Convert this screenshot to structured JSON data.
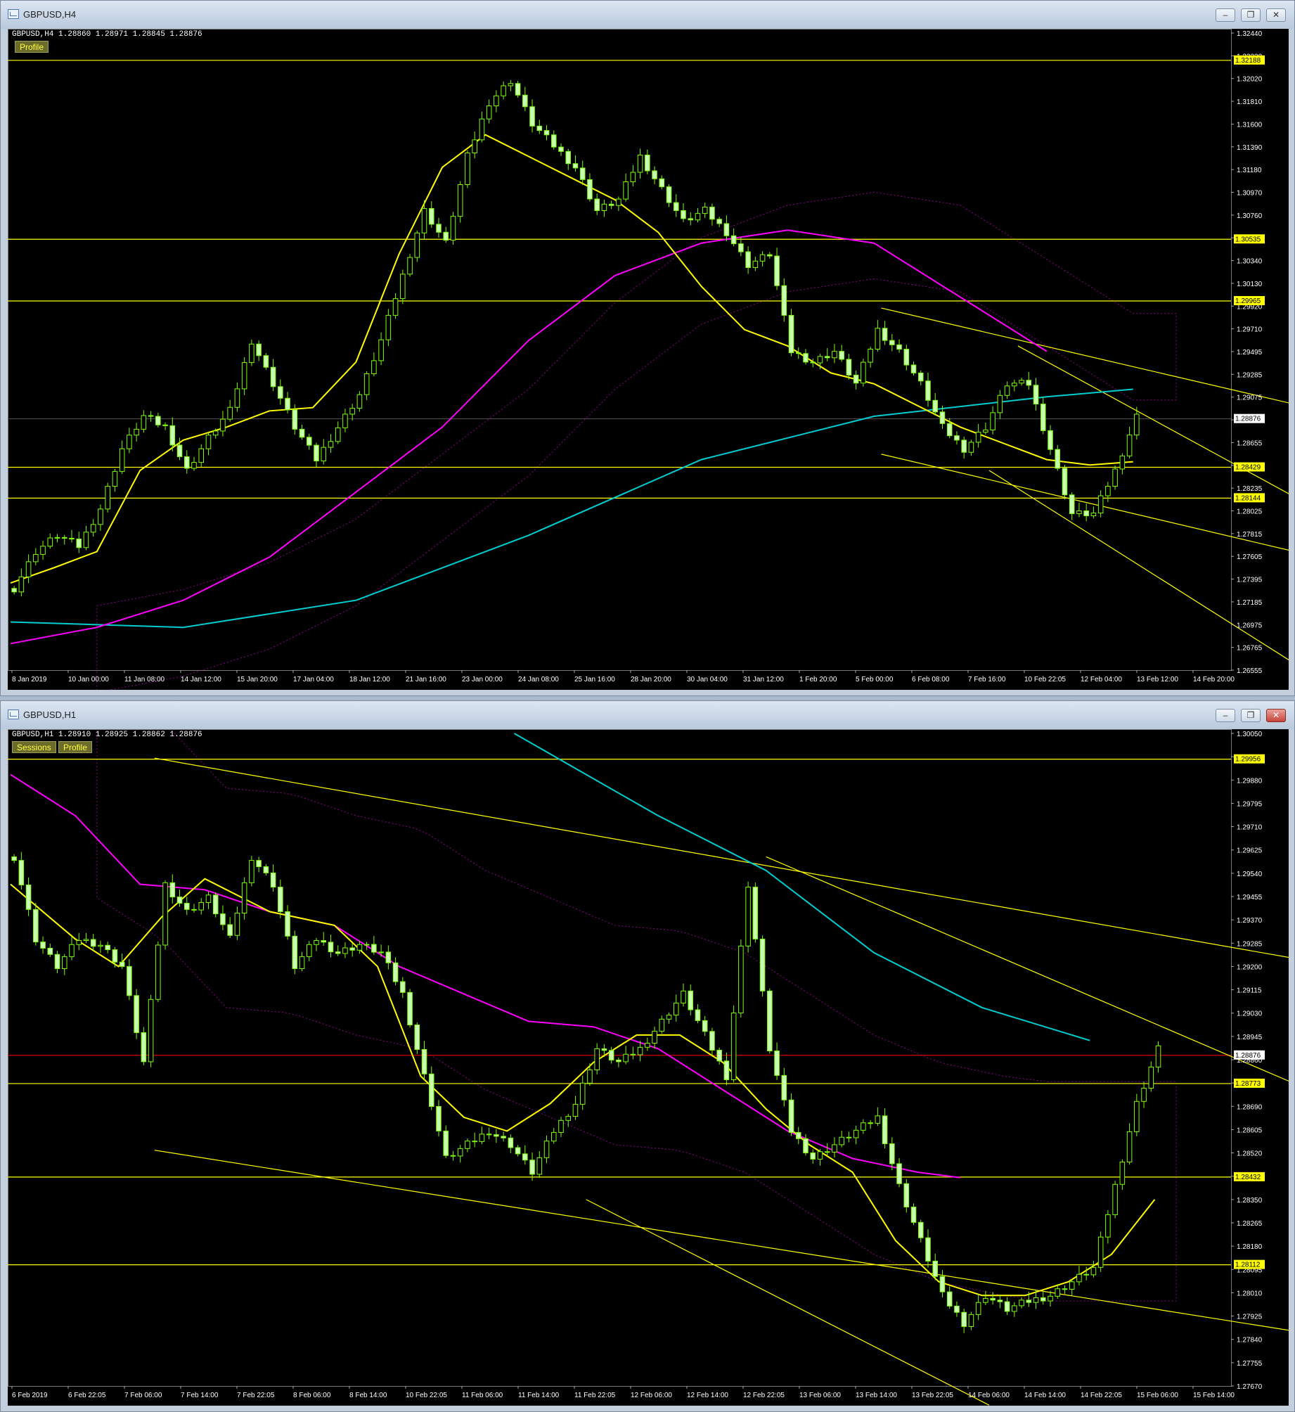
{
  "windows": [
    {
      "title": "GBPUSD,H4",
      "symbol_info": "GBPUSD,H4  1.28860 1.28971 1.28845 1.28876",
      "buttons": [
        "Profile"
      ],
      "price_scale": [
        "1.32440",
        "1.32230",
        "1.32020",
        "1.31810",
        "1.31600",
        "1.31390",
        "1.31180",
        "1.30970",
        "1.30760",
        "1.30545",
        "1.30340",
        "1.30130",
        "1.29920",
        "1.29710",
        "1.29495",
        "1.29285",
        "1.29075",
        "1.28865",
        "1.28655",
        "1.28445",
        "1.28235",
        "1.28025",
        "1.27815",
        "1.27605",
        "1.27395",
        "1.27185",
        "1.26975",
        "1.26765",
        "1.26555"
      ],
      "level_labels": [
        "1.32188",
        "1.30535",
        "1.29965",
        "1.28876",
        "1.28429",
        "1.28144"
      ],
      "time_labels": [
        "8 Jan 2019",
        "10 Jan 00:00",
        "11 Jan 08:00",
        "14 Jan 12:00",
        "15 Jan 20:00",
        "17 Jan 04:00",
        "18 Jan 12:00",
        "21 Jan 16:00",
        "23 Jan 00:00",
        "24 Jan 08:00",
        "25 Jan 16:00",
        "28 Jan 20:00",
        "30 Jan 04:00",
        "31 Jan 12:00",
        "1 Feb 20:00",
        "5 Feb 00:00",
        "6 Feb 08:00",
        "7 Feb 16:00",
        "10 Feb 22:05",
        "12 Feb 04:00",
        "13 Feb 12:00",
        "14 Feb 20:00"
      ]
    },
    {
      "title": "GBPUSD,H1",
      "symbol_info": "GBPUSD,H1  1.28910 1.28925 1.28862 1.28876",
      "buttons": [
        "Sessions",
        "Profile"
      ],
      "price_scale": [
        "1.30050",
        "1.29965",
        "1.29880",
        "1.29795",
        "1.29710",
        "1.29625",
        "1.29540",
        "1.29455",
        "1.29370",
        "1.29285",
        "1.29200",
        "1.29115",
        "1.29030",
        "1.28945",
        "1.28860",
        "1.28775",
        "1.28690",
        "1.28605",
        "1.28520",
        "1.28435",
        "1.28350",
        "1.28265",
        "1.28180",
        "1.28095",
        "1.28010",
        "1.27925",
        "1.27840",
        "1.27755",
        "1.27670"
      ],
      "level_labels": [
        "1.29956",
        "1.28876",
        "1.28773",
        "1.28432",
        "1.28112"
      ],
      "time_labels": [
        "6 Feb 2019",
        "6 Feb 22:05",
        "7 Feb 06:00",
        "7 Feb 14:00",
        "7 Feb 22:05",
        "8 Feb 06:00",
        "8 Feb 14:00",
        "10 Feb 22:05",
        "11 Feb 06:00",
        "11 Feb 14:00",
        "11 Feb 22:05",
        "12 Feb 06:00",
        "12 Feb 14:00",
        "12 Feb 22:05",
        "13 Feb 06:00",
        "13 Feb 14:00",
        "13 Feb 22:05",
        "14 Feb 06:00",
        "14 Feb 14:00",
        "14 Feb 22:05",
        "15 Feb 06:00",
        "15 Feb 14:00"
      ]
    }
  ],
  "controls": {
    "minimize_icon": "minimize-icon",
    "restore_icon": "restore-icon",
    "close_icon": "close-icon"
  },
  "colors": {
    "background": "#000000",
    "candle": "#7cfc00",
    "level": "#ffff00",
    "ma_fast": "#ffff00",
    "ma_mid": "#ff00ff",
    "ma_slow": "#00ced1",
    "cloud_bull": "#00ced1",
    "cloud_bear": "#ff00ff",
    "current_price": "#ff0000"
  },
  "chart_data": [
    {
      "type": "candlestick",
      "title": "GBPUSD,H4",
      "ylim": [
        1.26555,
        1.3244
      ],
      "current_price": 1.28876,
      "horizontal_levels": [
        1.32188,
        1.30535,
        1.29965,
        1.28429,
        1.28144
      ],
      "close_path": [
        [
          0,
          1.2731
        ],
        [
          3,
          1.2765
        ],
        [
          6,
          1.278
        ],
        [
          9,
          1.277
        ],
        [
          12,
          1.2805
        ],
        [
          15,
          1.286
        ],
        [
          18,
          1.289
        ],
        [
          21,
          1.288
        ],
        [
          24,
          1.284
        ],
        [
          27,
          1.287
        ],
        [
          30,
          1.2895
        ],
        [
          33,
          1.296
        ],
        [
          36,
          1.292
        ],
        [
          39,
          1.288
        ],
        [
          42,
          1.285
        ],
        [
          45,
          1.288
        ],
        [
          48,
          1.291
        ],
        [
          51,
          1.296
        ],
        [
          54,
          1.302
        ],
        [
          57,
          1.308
        ],
        [
          60,
          1.305
        ],
        [
          63,
          1.313
        ],
        [
          66,
          1.318
        ],
        [
          69,
          1.32
        ],
        [
          72,
          1.316
        ],
        [
          75,
          1.314
        ],
        [
          78,
          1.312
        ],
        [
          81,
          1.308
        ],
        [
          84,
          1.309
        ],
        [
          87,
          1.313
        ],
        [
          90,
          1.31
        ],
        [
          93,
          1.307
        ],
        [
          96,
          1.308
        ],
        [
          99,
          1.306
        ],
        [
          102,
          1.303
        ],
        [
          105,
          1.304
        ],
        [
          108,
          1.295
        ],
        [
          111,
          1.294
        ],
        [
          114,
          1.295
        ],
        [
          117,
          1.292
        ],
        [
          120,
          1.297
        ],
        [
          123,
          1.295
        ],
        [
          126,
          1.292
        ],
        [
          129,
          1.288
        ],
        [
          132,
          1.286
        ],
        [
          135,
          1.288
        ],
        [
          138,
          1.292
        ],
        [
          141,
          1.292
        ],
        [
          144,
          1.286
        ],
        [
          147,
          1.28
        ],
        [
          150,
          1.28
        ],
        [
          153,
          1.284
        ],
        [
          156,
          1.289
        ]
      ],
      "ma_fast": [
        [
          0,
          1.2736
        ],
        [
          6,
          1.275
        ],
        [
          12,
          1.2765
        ],
        [
          18,
          1.284
        ],
        [
          24,
          1.2868
        ],
        [
          30,
          1.288
        ],
        [
          36,
          1.2895
        ],
        [
          42,
          1.2898
        ],
        [
          48,
          1.294
        ],
        [
          54,
          1.304
        ],
        [
          60,
          1.312
        ],
        [
          66,
          1.315
        ],
        [
          72,
          1.313
        ],
        [
          78,
          1.311
        ],
        [
          84,
          1.309
        ],
        [
          90,
          1.306
        ],
        [
          96,
          1.301
        ],
        [
          102,
          1.297
        ],
        [
          108,
          1.2955
        ],
        [
          114,
          1.293
        ],
        [
          120,
          1.292
        ],
        [
          126,
          1.29
        ],
        [
          132,
          1.288
        ],
        [
          138,
          1.2865
        ],
        [
          144,
          1.285
        ],
        [
          150,
          1.2845
        ],
        [
          156,
          1.2848
        ]
      ],
      "ma_mid": [
        [
          0,
          1.268
        ],
        [
          12,
          1.2695
        ],
        [
          24,
          1.272
        ],
        [
          36,
          1.276
        ],
        [
          48,
          1.282
        ],
        [
          60,
          1.288
        ],
        [
          72,
          1.296
        ],
        [
          84,
          1.302
        ],
        [
          96,
          1.305
        ],
        [
          108,
          1.3062
        ],
        [
          120,
          1.305
        ],
        [
          132,
          1.3
        ],
        [
          144,
          1.295
        ]
      ],
      "ma_slow": [
        [
          0,
          1.27
        ],
        [
          24,
          1.2695
        ],
        [
          48,
          1.272
        ],
        [
          72,
          1.278
        ],
        [
          96,
          1.285
        ],
        [
          120,
          1.289
        ],
        [
          144,
          1.2908
        ],
        [
          156,
          1.2915
        ]
      ],
      "trendlines": [
        [
          [
            121,
            1.299
          ],
          [
            205,
            1.286
          ]
        ],
        [
          [
            140,
            1.2955
          ],
          [
            202,
            1.273
          ]
        ],
        [
          [
            121,
            1.2855
          ],
          [
            204,
            1.2725
          ]
        ],
        [
          [
            136,
            1.284
          ],
          [
            180,
            1.2655
          ]
        ]
      ]
    },
    {
      "type": "candlestick",
      "title": "GBPUSD,H1",
      "ylim": [
        1.2767,
        1.3005
      ],
      "current_price": 1.28876,
      "horizontal_levels": [
        1.29956,
        1.28773,
        1.28432,
        1.28112
      ],
      "close_path": [
        [
          0,
          1.296
        ],
        [
          3,
          1.293
        ],
        [
          6,
          1.292
        ],
        [
          9,
          1.293
        ],
        [
          12,
          1.2928
        ],
        [
          15,
          1.292
        ],
        [
          18,
          1.2885
        ],
        [
          21,
          1.295
        ],
        [
          24,
          1.294
        ],
        [
          27,
          1.2945
        ],
        [
          30,
          1.293
        ],
        [
          33,
          1.296
        ],
        [
          36,
          1.295
        ],
        [
          39,
          1.292
        ],
        [
          42,
          1.293
        ],
        [
          45,
          1.2925
        ],
        [
          48,
          1.2928
        ],
        [
          51,
          1.2925
        ],
        [
          54,
          1.291
        ],
        [
          57,
          1.288
        ],
        [
          60,
          1.285
        ],
        [
          63,
          1.2855
        ],
        [
          66,
          1.286
        ],
        [
          69,
          1.2855
        ],
        [
          72,
          1.2845
        ],
        [
          75,
          1.286
        ],
        [
          78,
          1.287
        ],
        [
          81,
          1.289
        ],
        [
          84,
          1.2885
        ],
        [
          87,
          1.289
        ],
        [
          90,
          1.29
        ],
        [
          93,
          1.291
        ],
        [
          96,
          1.2895
        ],
        [
          99,
          1.288
        ],
        [
          102,
          1.295
        ],
        [
          105,
          1.289
        ],
        [
          108,
          1.286
        ],
        [
          111,
          1.285
        ],
        [
          114,
          1.2855
        ],
        [
          117,
          1.286
        ],
        [
          120,
          1.2865
        ],
        [
          123,
          1.284
        ],
        [
          126,
          1.282
        ],
        [
          129,
          1.28
        ],
        [
          132,
          1.279
        ],
        [
          135,
          1.28
        ],
        [
          138,
          1.2795
        ],
        [
          141,
          1.2798
        ],
        [
          144,
          1.28
        ],
        [
          147,
          1.2805
        ],
        [
          150,
          1.281
        ],
        [
          153,
          1.284
        ],
        [
          156,
          1.287
        ],
        [
          159,
          1.289
        ]
      ],
      "ma_fast": [
        [
          0,
          1.295
        ],
        [
          9,
          1.293
        ],
        [
          15,
          1.292
        ],
        [
          21,
          1.2938
        ],
        [
          27,
          1.2952
        ],
        [
          36,
          1.294
        ],
        [
          45,
          1.2935
        ],
        [
          51,
          1.292
        ],
        [
          57,
          1.288
        ],
        [
          63,
          1.2865
        ],
        [
          69,
          1.286
        ],
        [
          75,
          1.287
        ],
        [
          81,
          1.2885
        ],
        [
          87,
          1.2895
        ],
        [
          93,
          1.2895
        ],
        [
          99,
          1.2885
        ],
        [
          105,
          1.2868
        ],
        [
          111,
          1.2855
        ],
        [
          117,
          1.2845
        ],
        [
          123,
          1.282
        ],
        [
          129,
          1.2805
        ],
        [
          135,
          1.28
        ],
        [
          141,
          1.28
        ],
        [
          147,
          1.2805
        ],
        [
          153,
          1.2815
        ],
        [
          159,
          1.2835
        ]
      ],
      "ma_mid": [
        [
          0,
          1.299
        ],
        [
          9,
          1.2975
        ],
        [
          18,
          1.295
        ],
        [
          27,
          1.2948
        ],
        [
          36,
          1.294
        ],
        [
          45,
          1.2935
        ],
        [
          54,
          1.292
        ],
        [
          63,
          1.291
        ],
        [
          72,
          1.29
        ],
        [
          81,
          1.2898
        ],
        [
          90,
          1.289
        ],
        [
          99,
          1.2875
        ],
        [
          108,
          1.286
        ],
        [
          117,
          1.285
        ],
        [
          126,
          1.2845
        ],
        [
          132,
          1.2843
        ]
      ],
      "ma_slow": [
        [
          70,
          1.3005
        ],
        [
          90,
          1.2975
        ],
        [
          105,
          1.2955
        ],
        [
          120,
          1.2925
        ],
        [
          135,
          1.2905
        ],
        [
          150,
          1.2893
        ]
      ],
      "trendlines": [
        [
          [
            20,
            1.2996
          ],
          [
            200,
            1.2913
          ]
        ],
        [
          [
            105,
            1.296
          ],
          [
            200,
            1.2853
          ]
        ],
        [
          [
            20,
            1.2853
          ],
          [
            200,
            1.2778
          ]
        ],
        [
          [
            80,
            1.2835
          ],
          [
            136,
            1.276
          ]
        ]
      ]
    }
  ]
}
